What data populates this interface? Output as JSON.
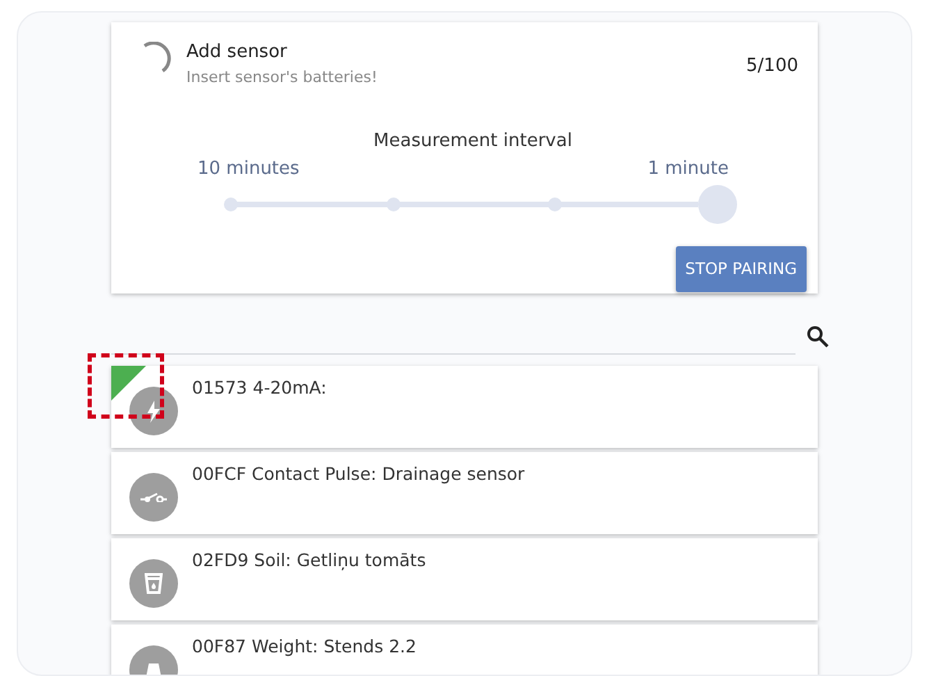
{
  "pairing": {
    "title": "Add sensor",
    "subtitle": "Insert sensor's batteries!",
    "count": "5/100",
    "interval": {
      "label": "Measurement interval",
      "min_label": "10 minutes",
      "max_label": "1 minute",
      "level": 1
    },
    "button": "STOP PAIRING"
  },
  "sensors": [
    {
      "kind": "current",
      "label": "01573 4-20mA:",
      "color": "#4caf50",
      "highlighted": true
    },
    {
      "kind": "contact",
      "label": "00FCF Contact Pulse: Drainage sensor",
      "highlighted": false
    },
    {
      "kind": "soil",
      "label": "02FD9 Soil: Getliņu tomāts",
      "highlighted": false
    },
    {
      "kind": "weight",
      "label": "00F87 Weight: Stends 2.2",
      "highlighted": false
    }
  ]
}
